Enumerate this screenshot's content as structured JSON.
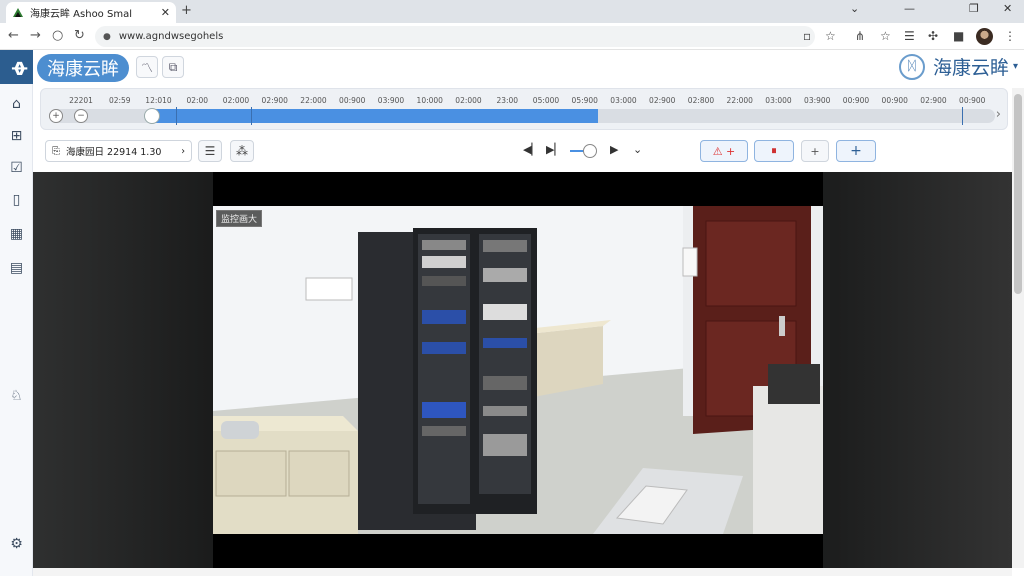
{
  "browser": {
    "tab_title": "海康云眸 Ashoo Smal",
    "tab_close": "✕",
    "new_tab": "+",
    "url": "www.agndwsegohels",
    "window_controls": [
      "⌄",
      "—",
      "❐",
      "✕"
    ]
  },
  "header": {
    "brand_left": "海康云眸",
    "brand_right": "海康云眸",
    "brand_right_logo": "hcy-logo-icon",
    "caret": "▾"
  },
  "timeline": {
    "ticks": [
      "22201",
      "02:59",
      "12:010",
      "02:00",
      "02:000",
      "02:900",
      "22:000",
      "00:900",
      "03:900",
      "10:000",
      "02:000",
      "23:00",
      "05:000",
      "05:900",
      "03:000",
      "02:900",
      "02:800",
      "22:000",
      "03:000",
      "03:900",
      "00:900",
      "00:900",
      "02:900",
      "00:900"
    ],
    "progress": 0.58,
    "prev_label": "+",
    "zoom_label": "−",
    "next_label": "›"
  },
  "toolbar": {
    "date_text": "海康园日 22914 1.30",
    "date_caret": "›",
    "list_icon": "☰",
    "grid_icon": "⁂",
    "prev_frame": "◀▏",
    "next_frame": "▶▏",
    "play": "▶",
    "more": "⌄",
    "alarm_label": "⚠ +",
    "stop_label": "⏸",
    "add_label": "+",
    "add_blue_label": "+"
  },
  "video": {
    "camera_label": "监控画大"
  },
  "colors": {
    "accent": "#4a90e2",
    "brand": "#2c5d8f"
  }
}
